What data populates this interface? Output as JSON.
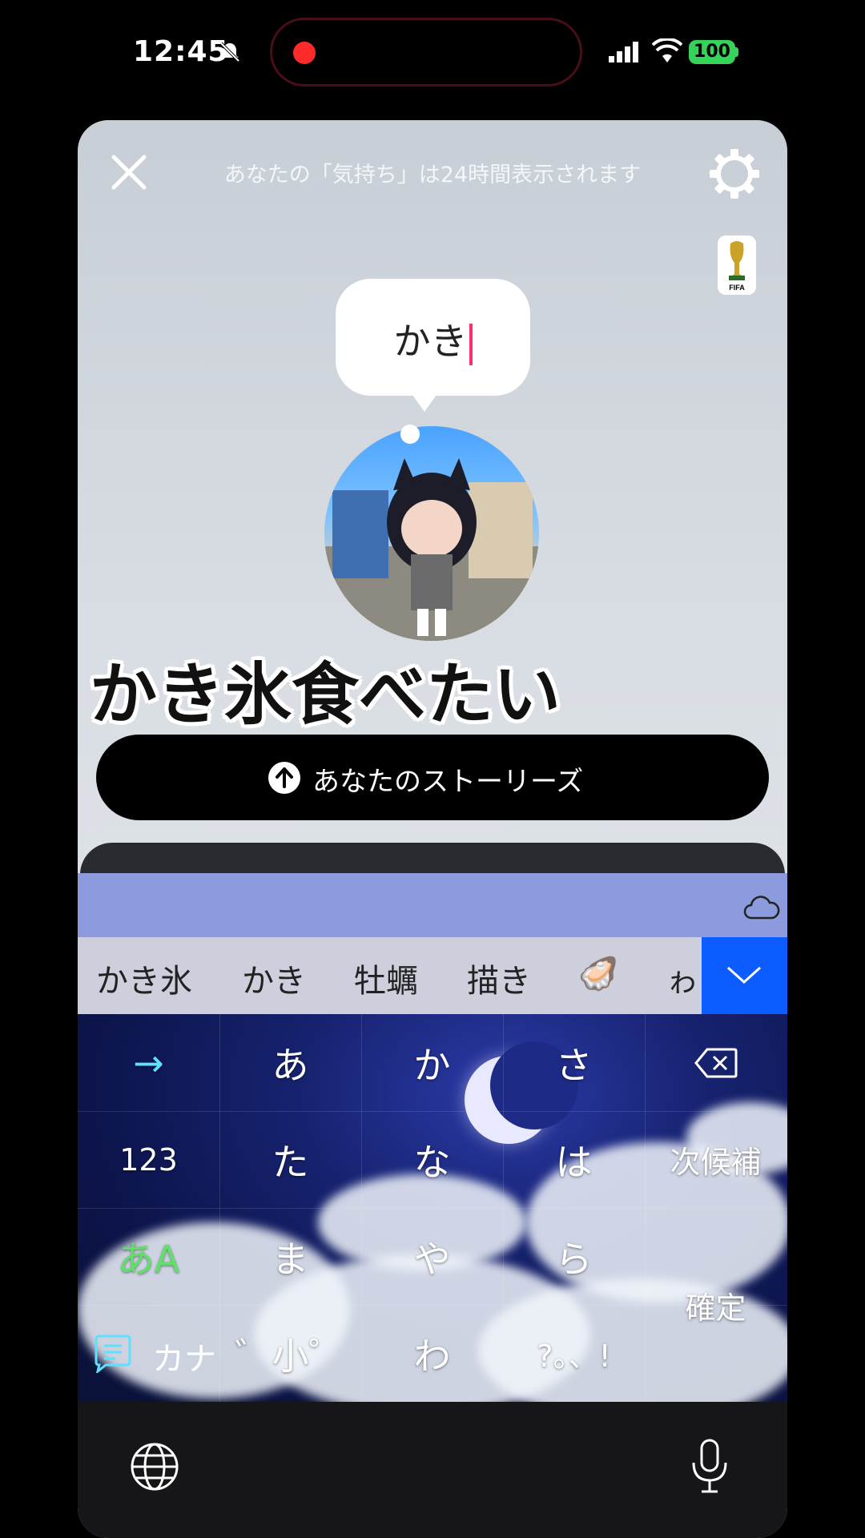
{
  "status_bar": {
    "time": "12:45",
    "battery": "100"
  },
  "header": {
    "note": "あなたの「気持ち」は24時間表示されます"
  },
  "bubble": {
    "text": "かき"
  },
  "mood": {
    "text": "かき氷食べたい"
  },
  "story_button": {
    "label": "あなたのストーリーズ"
  },
  "badge": {
    "label": "FIFA"
  },
  "keyboard": {
    "candidates": [
      "かき氷",
      "かき",
      "牡蠣",
      "描き",
      "🦪",
      "ゎ"
    ],
    "rows": [
      [
        "→",
        "あ",
        "か",
        "さ",
        "⌫"
      ],
      [
        "123",
        "た",
        "な",
        "は",
        "次候補"
      ],
      [
        "あA",
        "ま",
        "や",
        "ら",
        "確定"
      ],
      [
        "カナ",
        "゛小゜",
        "わ",
        "?。、!",
        ""
      ]
    ],
    "colors": {
      "accent": "#0d5cff",
      "strip": "#8c9ade"
    }
  },
  "icons": [
    "close-icon",
    "gear-icon",
    "upload-arrow-icon",
    "cloud-icon",
    "chevron-down-icon",
    "backspace-icon",
    "chat-icon",
    "globe-icon",
    "mic-icon"
  ]
}
